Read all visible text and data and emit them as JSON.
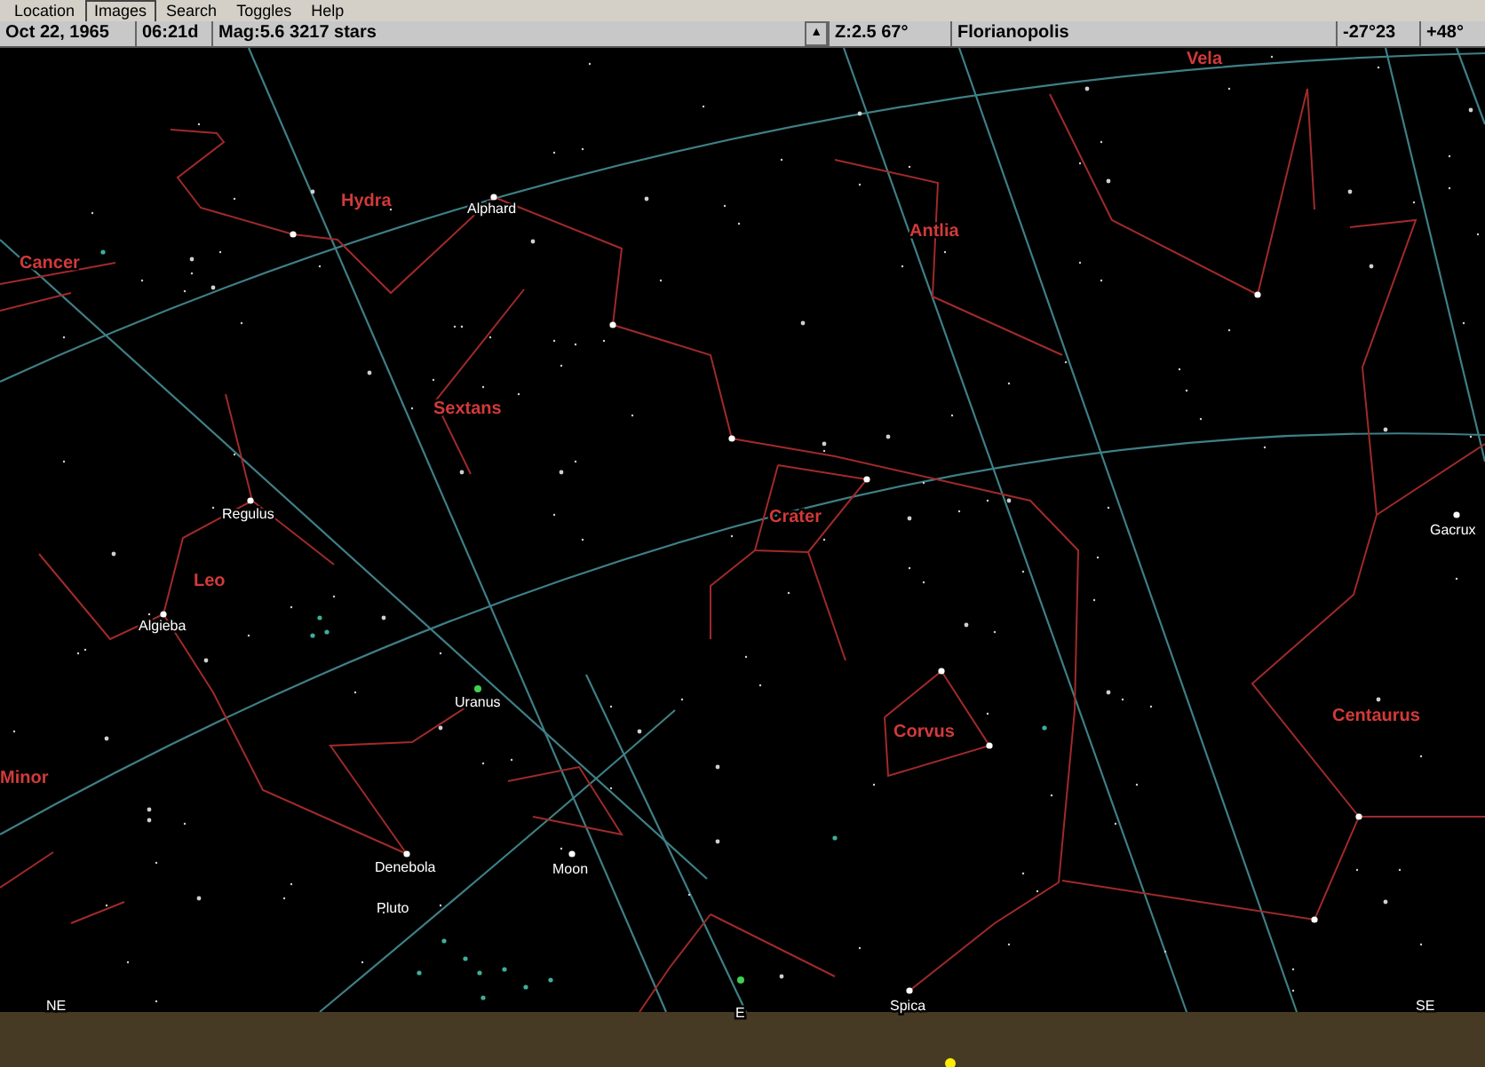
{
  "menu": [
    {
      "label": "Location",
      "selected": false
    },
    {
      "label": "Images",
      "selected": true
    },
    {
      "label": "Search",
      "selected": false
    },
    {
      "label": "Toggles",
      "selected": false
    },
    {
      "label": "Help",
      "selected": false
    }
  ],
  "status_bar": {
    "date": "Oct 22, 1965",
    "time": "06:21d",
    "magnitude": "Mag:5.6  3217 stars",
    "scroll_button": "▲",
    "zoom": "Z:2.5  67°",
    "location": "Florianopolis",
    "latitude": "-27°23",
    "longitude": "+48°"
  },
  "sky_labels": [
    {
      "text": "Vela",
      "kind": "constellation"
    },
    {
      "text": "Hydra",
      "kind": "constellation"
    },
    {
      "text": "Alphard",
      "kind": "star"
    },
    {
      "text": "Antlia",
      "kind": "constellation"
    },
    {
      "text": "Cancer",
      "kind": "constellation"
    },
    {
      "text": "Sextans",
      "kind": "constellation"
    },
    {
      "text": "Regulus",
      "kind": "star"
    },
    {
      "text": "Crater",
      "kind": "constellation"
    },
    {
      "text": "Gacrux",
      "kind": "star"
    },
    {
      "text": "Leo",
      "kind": "constellation"
    },
    {
      "text": "Algieba",
      "kind": "star"
    },
    {
      "text": "Uranus",
      "kind": "star"
    },
    {
      "text": "Corvus",
      "kind": "constellation"
    },
    {
      "text": "Centaurus",
      "kind": "constellation"
    },
    {
      "text": "Minor",
      "kind": "constellation"
    },
    {
      "text": "Denebola",
      "kind": "star"
    },
    {
      "text": "Moon",
      "kind": "star"
    },
    {
      "text": "Pluto",
      "kind": "star"
    },
    {
      "text": "NE",
      "kind": "compass"
    },
    {
      "text": "E",
      "kind": "compass"
    },
    {
      "text": "Spica",
      "kind": "star"
    },
    {
      "text": "SE",
      "kind": "compass"
    }
  ]
}
